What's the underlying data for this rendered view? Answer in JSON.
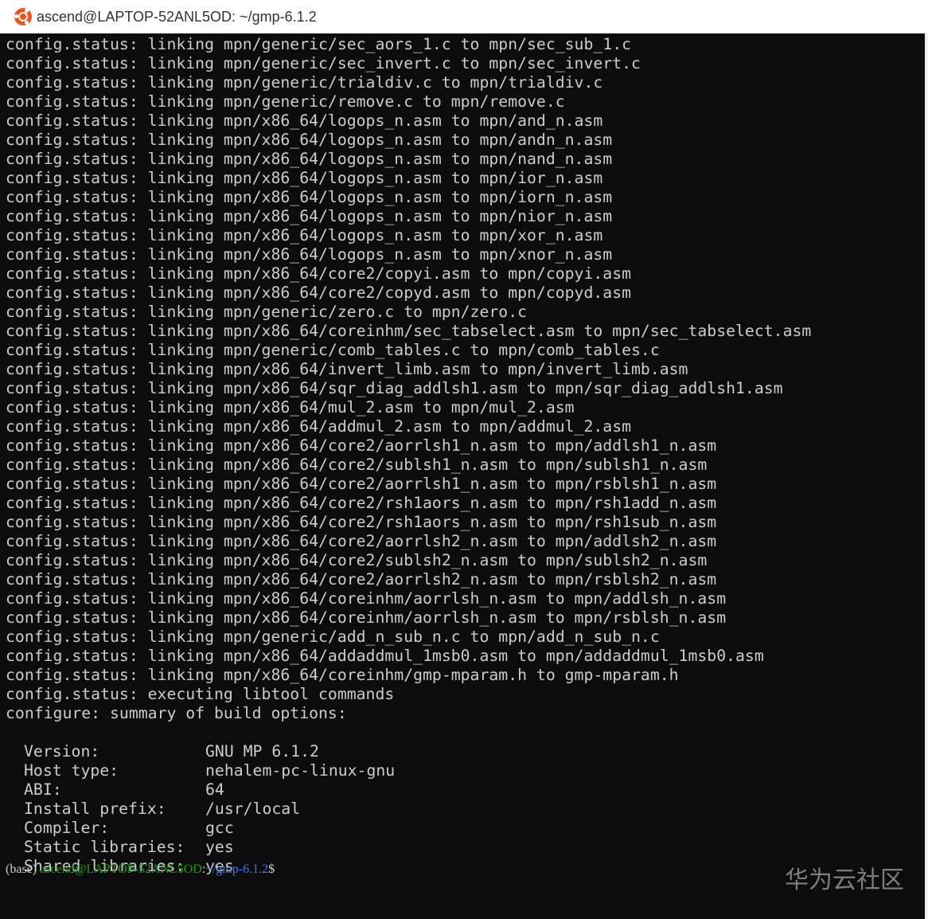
{
  "window": {
    "title": "ascend@LAPTOP-52ANL5OD: ~/gmp-6.1.2",
    "icon": "ubuntu-icon",
    "accent": "#e95420"
  },
  "terminal": {
    "lines": [
      "config.status: linking mpn/generic/sec_aors_1.c to mpn/sec_sub_1.c",
      "config.status: linking mpn/generic/sec_invert.c to mpn/sec_invert.c",
      "config.status: linking mpn/generic/trialdiv.c to mpn/trialdiv.c",
      "config.status: linking mpn/generic/remove.c to mpn/remove.c",
      "config.status: linking mpn/x86_64/logops_n.asm to mpn/and_n.asm",
      "config.status: linking mpn/x86_64/logops_n.asm to mpn/andn_n.asm",
      "config.status: linking mpn/x86_64/logops_n.asm to mpn/nand_n.asm",
      "config.status: linking mpn/x86_64/logops_n.asm to mpn/ior_n.asm",
      "config.status: linking mpn/x86_64/logops_n.asm to mpn/iorn_n.asm",
      "config.status: linking mpn/x86_64/logops_n.asm to mpn/nior_n.asm",
      "config.status: linking mpn/x86_64/logops_n.asm to mpn/xor_n.asm",
      "config.status: linking mpn/x86_64/logops_n.asm to mpn/xnor_n.asm",
      "config.status: linking mpn/x86_64/core2/copyi.asm to mpn/copyi.asm",
      "config.status: linking mpn/x86_64/core2/copyd.asm to mpn/copyd.asm",
      "config.status: linking mpn/generic/zero.c to mpn/zero.c",
      "config.status: linking mpn/x86_64/coreinhm/sec_tabselect.asm to mpn/sec_tabselect.asm",
      "config.status: linking mpn/generic/comb_tables.c to mpn/comb_tables.c",
      "config.status: linking mpn/x86_64/invert_limb.asm to mpn/invert_limb.asm",
      "config.status: linking mpn/x86_64/sqr_diag_addlsh1.asm to mpn/sqr_diag_addlsh1.asm",
      "config.status: linking mpn/x86_64/mul_2.asm to mpn/mul_2.asm",
      "config.status: linking mpn/x86_64/addmul_2.asm to mpn/addmul_2.asm",
      "config.status: linking mpn/x86_64/core2/aorrlsh1_n.asm to mpn/addlsh1_n.asm",
      "config.status: linking mpn/x86_64/core2/sublsh1_n.asm to mpn/sublsh1_n.asm",
      "config.status: linking mpn/x86_64/core2/aorrlsh1_n.asm to mpn/rsblsh1_n.asm",
      "config.status: linking mpn/x86_64/core2/rsh1aors_n.asm to mpn/rsh1add_n.asm",
      "config.status: linking mpn/x86_64/core2/rsh1aors_n.asm to mpn/rsh1sub_n.asm",
      "config.status: linking mpn/x86_64/core2/aorrlsh2_n.asm to mpn/addlsh2_n.asm",
      "config.status: linking mpn/x86_64/core2/sublsh2_n.asm to mpn/sublsh2_n.asm",
      "config.status: linking mpn/x86_64/core2/aorrlsh2_n.asm to mpn/rsblsh2_n.asm",
      "config.status: linking mpn/x86_64/coreinhm/aorrlsh_n.asm to mpn/addlsh_n.asm",
      "config.status: linking mpn/x86_64/coreinhm/aorrlsh_n.asm to mpn/rsblsh_n.asm",
      "config.status: linking mpn/generic/add_n_sub_n.c to mpn/add_n_sub_n.c",
      "config.status: linking mpn/x86_64/addaddmul_1msb0.asm to mpn/addaddmul_1msb0.asm",
      "config.status: linking mpn/x86_64/coreinhm/gmp-mparam.h to gmp-mparam.h",
      "config.status: executing libtool commands",
      "configure: summary of build options:"
    ],
    "summary": [
      {
        "label": "Version:",
        "value": "GNU MP 6.1.2"
      },
      {
        "label": "Host type:",
        "value": "nehalem-pc-linux-gnu"
      },
      {
        "label": "ABI:",
        "value": "64"
      },
      {
        "label": "Install prefix:",
        "value": "/usr/local"
      },
      {
        "label": "Compiler:",
        "value": "gcc"
      },
      {
        "label": "Static libraries:",
        "value": "yes"
      },
      {
        "label": "Shared libraries:",
        "value": "yes"
      }
    ],
    "prompt": {
      "env": "(base) ",
      "user": "ascend@LAPTOP-52ANL5OD",
      "sep": ":",
      "path": "~/gmp-6.1.2",
      "symbol": "$"
    },
    "colors": {
      "background": "#0c0c0c",
      "text": "#cccccc",
      "user": "#13a10e",
      "path": "#3b78ff"
    }
  },
  "watermark": "华为云社区"
}
